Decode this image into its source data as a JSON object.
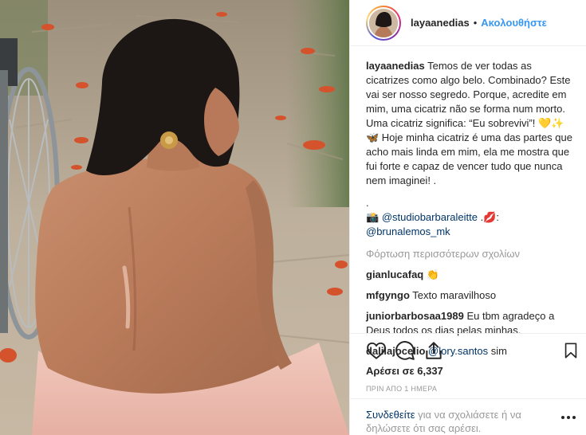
{
  "post": {
    "username": "layaanedias",
    "dot": "•",
    "follow_label": "Ακολουθήστε",
    "caption_text": "Temos de ver todas as cicatrizes como algo belo. Combinado? Este vai ser nosso segredo. Porque, acredite em mim, uma cicatriz não se forma num morto. Uma cicatriz significa: “Eu sobrevivi”! 💛✨🦋 Hoje minha cicatriz é uma das partes que acho mais linda em mim, ela me mostra que fui forte e capaz de vencer tudo que nunca nem imaginei! .",
    "caption_dot": ".",
    "credit_icon": "📸",
    "credit_mention_1": "@studiobarbaraleitte",
    "credit_mid": " .💋:",
    "credit_mention_2": "@brunalemos_mk",
    "load_more": "Φόρτωση περισσότερων σχολίων",
    "comments": [
      {
        "user": "gianlucafaq",
        "text": "👏"
      },
      {
        "user": "mfgyngo",
        "text": "Texto maravilhoso"
      },
      {
        "user": "juniorbarbosaa1989",
        "text": "Eu tbm agradeço a Deus todos os dias pelas minhas."
      },
      {
        "user": "dalilajocelio",
        "mention": "@lory.santos",
        "text": " sim"
      }
    ],
    "likes": "Αρέσει σε 6,337",
    "time_ago": "ΠΡΙΝ ΑΠΟ 1 ΗΜΕΡΑ",
    "login_link": "Συνδεθείτε",
    "login_rest": " για να σχολιάσετε ή να δηλώσετε ότι σας αρέσει."
  },
  "icons": {
    "heart": "heart-icon",
    "comment": "comment-icon",
    "share": "share-icon",
    "bookmark": "bookmark-icon",
    "more": "more-options-icon"
  },
  "colors": {
    "link_blue": "#3897f0",
    "mention_blue": "#003569",
    "muted_gray": "#999999",
    "text": "#262626"
  }
}
